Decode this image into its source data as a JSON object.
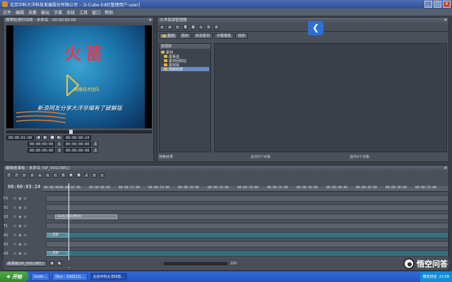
{
  "window": {
    "title": "北京中科大洋科技发展股份有限公司 -- D-Cube-Edit[管理用户:user]",
    "controls": [
      "_",
      "□",
      "✕"
    ]
  },
  "menu": [
    "文件",
    "编辑",
    "采集",
    "输出",
    "字幕",
    "系统",
    "工具",
    "窗口",
    "帮助"
  ],
  "preview": {
    "header": "故障检测时间线 - 未命名 - 00:00:00:00",
    "logo": "火苗",
    "sublogo": "眼眉技术团队",
    "caption": "新浪网友分享大洋非编有了破解版",
    "timecodes": [
      "00:00:01:00",
      "00:00:00:24",
      "00:00:00:00",
      "00:00:00:00",
      "00:00:00:00",
      "00:00:00:00",
      "00:00:00:00",
      "00:00:00:00"
    ]
  },
  "resource": {
    "header": "大洋资源管理器",
    "tabs": [
      "素材",
      "剧目",
      "轨道素材",
      "字幕模板",
      "特技"
    ],
    "tree_label": "资源库",
    "tree": [
      "素材",
      "故事夹",
      "素材回收站",
      "素材库",
      "搜索结果"
    ],
    "status": [
      "搜索结果",
      "总共0个对象",
      "选中0个对象"
    ]
  },
  "timeline": {
    "header": "编辑故事板 - 未命名 (SP_001CREC)",
    "current_tc": "00:00:03:24",
    "ruler": [
      "00:00:00",
      "00:00:04:00",
      "00:00:08:00",
      "00:00:12:00",
      "00:00:16:00",
      "00:00:20:00",
      "00:00:24:00",
      "00:00:28:00",
      "00:00:32:00",
      "00:00:36:00",
      "00:00:40:00",
      "00:00:44:00",
      "00:00:48:00",
      "00:00:52:00"
    ],
    "tracks": [
      {
        "label": "FX",
        "kind": "video",
        "clip": ""
      },
      {
        "label": "V1",
        "kind": "video",
        "clip": ""
      },
      {
        "label": "V2",
        "kind": "video",
        "clip": "vvv5_02C拷贝0"
      },
      {
        "label": "T1",
        "kind": "video",
        "clip": ""
      },
      {
        "label": "A1",
        "kind": "audio",
        "clip": "v_音频"
      },
      {
        "label": "A2",
        "kind": "video",
        "clip": ""
      },
      {
        "label": "A3",
        "kind": "audio",
        "clip": "v_音频"
      }
    ],
    "bottom_tab": "故事板(SP_001CREC)",
    "zoom": "100"
  },
  "taskbar": {
    "start": "开始",
    "items": [
      "Untitl...",
      "Dtm - 10021/1...",
      "北京中科大洋科技..."
    ],
    "ime": "微软拼音",
    "time": "23:09"
  },
  "watermark": "悟空问答"
}
